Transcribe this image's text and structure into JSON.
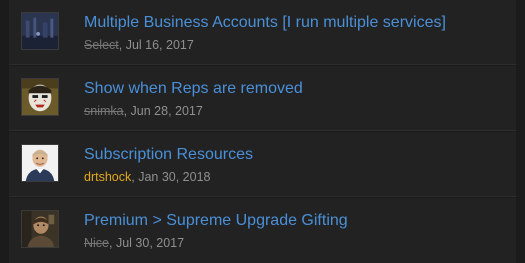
{
  "threads": [
    {
      "title": "Multiple Business Accounts [I run multiple services]",
      "author": "Select",
      "author_style": "banned",
      "date": ", Jul 16, 2017",
      "avatar_icon": "dark-scene-avatar"
    },
    {
      "title": "Show when Reps are removed",
      "author": "snimka",
      "author_style": "banned",
      "date": ", Jun 28, 2017",
      "avatar_icon": "masked-face-avatar"
    },
    {
      "title": "Subscription Resources",
      "author": "drtshock",
      "author_style": "gold",
      "date": ", Jan 30, 2018",
      "avatar_icon": "man-photo-avatar"
    },
    {
      "title": "Premium > Supreme Upgrade Gifting",
      "author": "Nice",
      "author_style": "banned",
      "date": ", Jul 30, 2017",
      "avatar_icon": "portrait-photo-avatar"
    }
  ],
  "colors": {
    "background": "#1b1b1b",
    "row": "#222222",
    "link": "#4a90d9",
    "meta": "#8f8f8f",
    "banned_author": "#777777",
    "gold_author": "#e0a81c"
  }
}
